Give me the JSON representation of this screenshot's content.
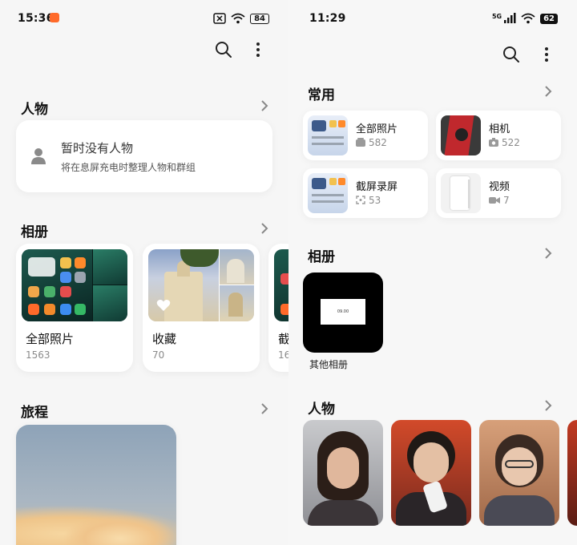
{
  "left": {
    "status": {
      "time": "15:36",
      "battery": "84"
    },
    "people": {
      "title": "人物",
      "empty_title": "暂时没有人物",
      "empty_desc": "将在息屏充电时整理人物和群组"
    },
    "albums": {
      "title": "相册",
      "items": [
        {
          "label": "全部照片",
          "count": "1563"
        },
        {
          "label": "收藏",
          "count": "70"
        },
        {
          "label": "截",
          "count": "16"
        }
      ]
    },
    "trips": {
      "title": "旅程"
    }
  },
  "right": {
    "status": {
      "time": "11:29",
      "network": "5G",
      "battery": "62"
    },
    "common": {
      "title": "常用",
      "items": [
        {
          "label": "全部照片",
          "count": "582",
          "icon": "album-icon"
        },
        {
          "label": "相机",
          "count": "522",
          "icon": "camera-icon"
        },
        {
          "label": "截屏录屏",
          "count": "53",
          "icon": "screenshot-icon"
        },
        {
          "label": "视频",
          "count": "7",
          "icon": "video-icon"
        }
      ]
    },
    "albums": {
      "title": "相册",
      "other_label": "其他相册",
      "preview_text": "09.00"
    },
    "people": {
      "title": "人物"
    }
  },
  "colors": {
    "accent": "#ff8a2b",
    "text": "#111111",
    "muted": "#8a8a8a"
  }
}
